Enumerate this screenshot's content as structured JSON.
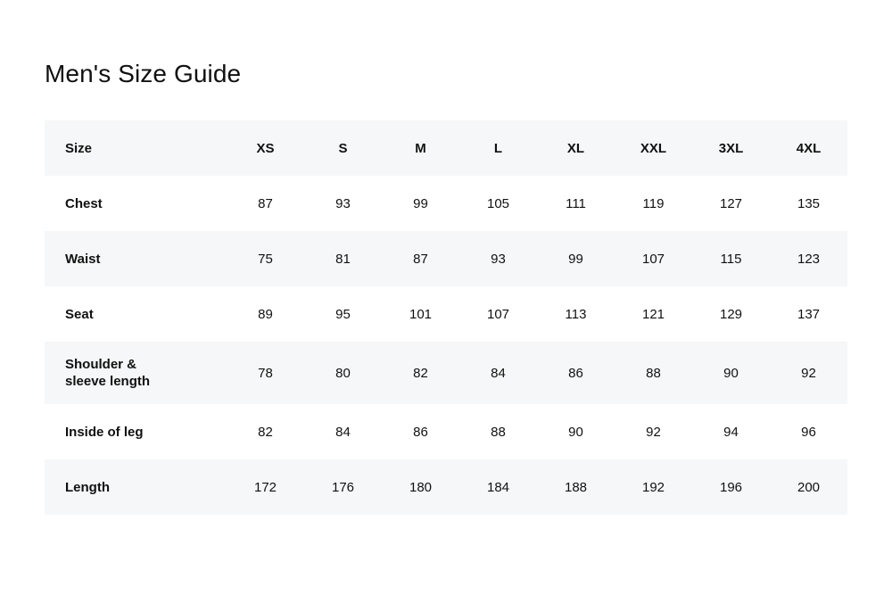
{
  "page": {
    "title": "Men's Size Guide",
    "background_color": "#ffffff",
    "text_color": "#111111",
    "row_shaded_color": "#f6f7f8"
  },
  "table": {
    "header": {
      "label": "Size",
      "sizes": [
        "XS",
        "S",
        "M",
        "L",
        "XL",
        "XXL",
        "3XL",
        "4XL"
      ]
    },
    "rows": [
      {
        "label": "Chest",
        "label_lines": [
          "Chest"
        ],
        "values": [
          "87",
          "93",
          "99",
          "105",
          "111",
          "119",
          "127",
          "135"
        ]
      },
      {
        "label": "Waist",
        "label_lines": [
          "Waist"
        ],
        "values": [
          "75",
          "81",
          "87",
          "93",
          "99",
          "107",
          "115",
          "123"
        ]
      },
      {
        "label": "Seat",
        "label_lines": [
          "Seat"
        ],
        "values": [
          "89",
          "95",
          "101",
          "107",
          "113",
          "121",
          "129",
          "137"
        ]
      },
      {
        "label": "Shoulder & sleeve length",
        "label_lines": [
          "Shoulder &",
          "sleeve length"
        ],
        "values": [
          "78",
          "80",
          "82",
          "84",
          "86",
          "88",
          "90",
          "92"
        ]
      },
      {
        "label": "Inside of leg",
        "label_lines": [
          "Inside of leg"
        ],
        "values": [
          "82",
          "84",
          "86",
          "88",
          "90",
          "92",
          "94",
          "96"
        ]
      },
      {
        "label": "Length",
        "label_lines": [
          "Length"
        ],
        "values": [
          "172",
          "176",
          "180",
          "184",
          "188",
          "192",
          "196",
          "200"
        ]
      }
    ]
  }
}
